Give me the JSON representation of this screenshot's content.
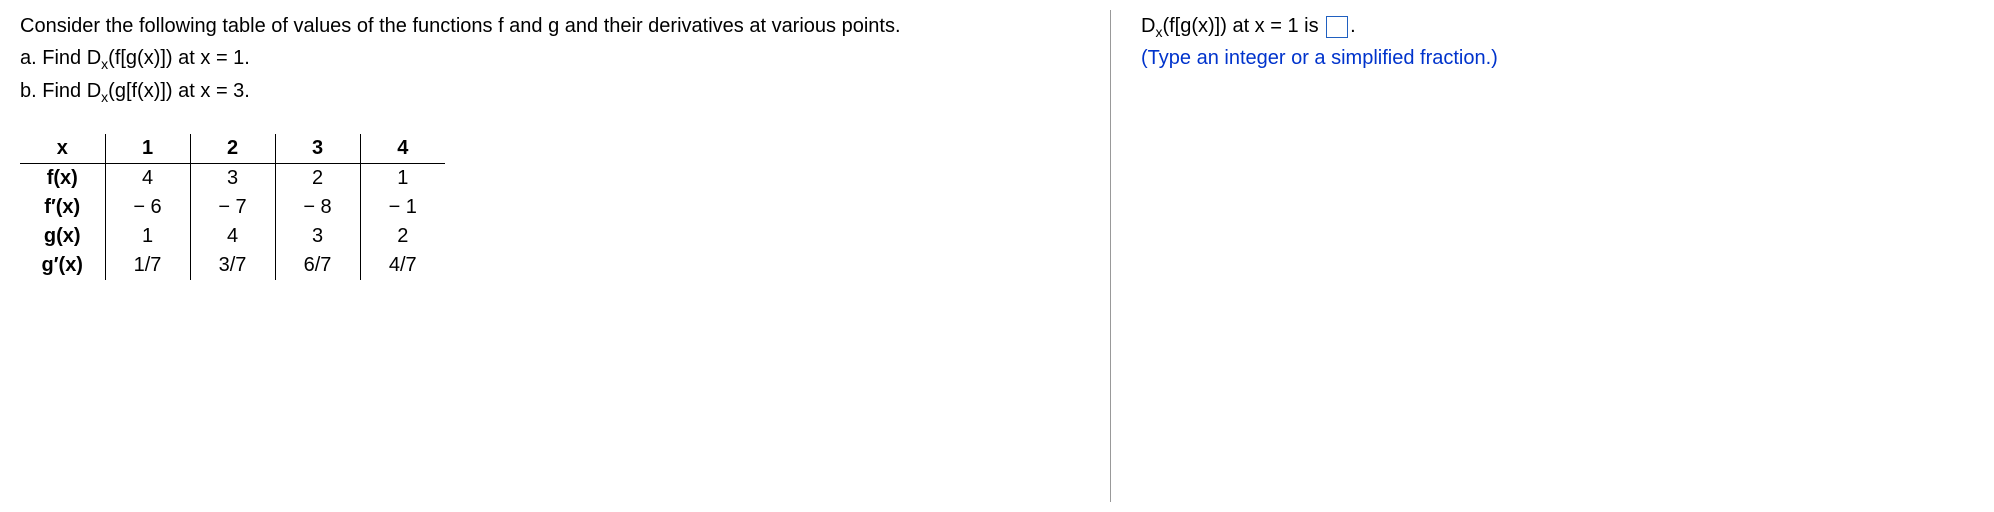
{
  "problem": {
    "intro": "Consider the following table of values of the functions f and g and their derivatives at various points.",
    "part_a_prefix": "a. Find D",
    "part_a_suffix": "(f[g(x)]) at x = 1.",
    "part_b_prefix": "b. Find D",
    "part_b_suffix": "(g[f(x)]) at x = 3.",
    "sub": "x"
  },
  "table": {
    "headers": [
      "x",
      "1",
      "2",
      "3",
      "4"
    ],
    "rows": [
      {
        "label": "f(x)",
        "values": [
          "4",
          "3",
          "2",
          "1"
        ]
      },
      {
        "label": "f′(x)",
        "values": [
          "− 6",
          "− 7",
          "− 8",
          "− 1"
        ]
      },
      {
        "label": "g(x)",
        "values": [
          "1",
          "4",
          "3",
          "2"
        ]
      },
      {
        "label": "g′(x)",
        "values": [
          "1/7",
          "3/7",
          "6/7",
          "4/7"
        ]
      }
    ]
  },
  "answer": {
    "prefix": "D",
    "sub": "x",
    "mid": "(f[g(x)]) at x = 1 is ",
    "suffix": ".",
    "instruction": "(Type an integer or a simplified fraction.)"
  }
}
